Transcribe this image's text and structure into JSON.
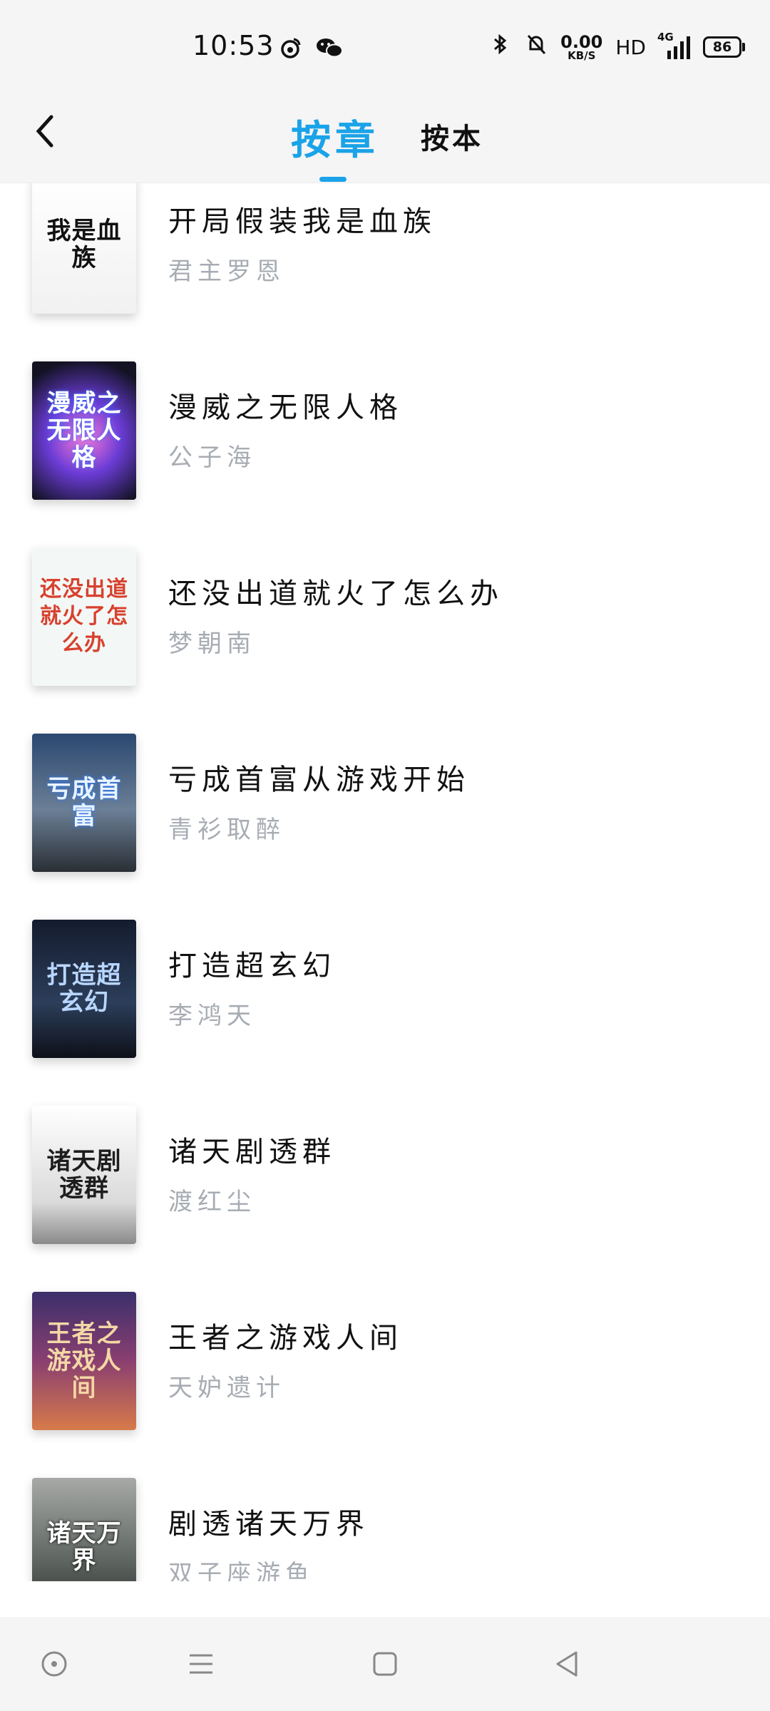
{
  "status_bar": {
    "time": "10:53",
    "app_icons": [
      "weibo-icon",
      "wechat-icon"
    ],
    "network_speed_value": "0.00",
    "network_speed_unit": "KB/S",
    "hd_label": "HD",
    "signal_label": "4G",
    "battery_level": "86"
  },
  "header": {
    "back_label": "‹",
    "tabs": [
      {
        "label": "按章",
        "active": true
      },
      {
        "label": "按本",
        "active": false
      }
    ],
    "accent_color": "#1aa3e8"
  },
  "books": [
    {
      "title": "开局假装我是血族",
      "author": "君主罗恩",
      "cover_text": "我是血族"
    },
    {
      "title": "漫威之无限人格",
      "author": "公子海",
      "cover_text": "漫威之无限人格"
    },
    {
      "title": "还没出道就火了怎么办",
      "author": "梦朝南",
      "cover_text": "还没出道就火了怎么办"
    },
    {
      "title": "亏成首富从游戏开始",
      "author": "青衫取醉",
      "cover_text": "亏成首富"
    },
    {
      "title": "打造超玄幻",
      "author": "李鸿天",
      "cover_text": "打造超玄幻"
    },
    {
      "title": "诸天剧透群",
      "author": "渡红尘",
      "cover_text": "诸天剧透群"
    },
    {
      "title": "王者之游戏人间",
      "author": "天妒遗计",
      "cover_text": "王者之游戏人间"
    },
    {
      "title": "剧透诸天万界",
      "author": "双子座游鱼",
      "cover_text": "诸天万界"
    }
  ],
  "nav_bar": [
    "circle-dot-icon",
    "menu-icon",
    "home-square-icon",
    "back-triangle-icon"
  ]
}
